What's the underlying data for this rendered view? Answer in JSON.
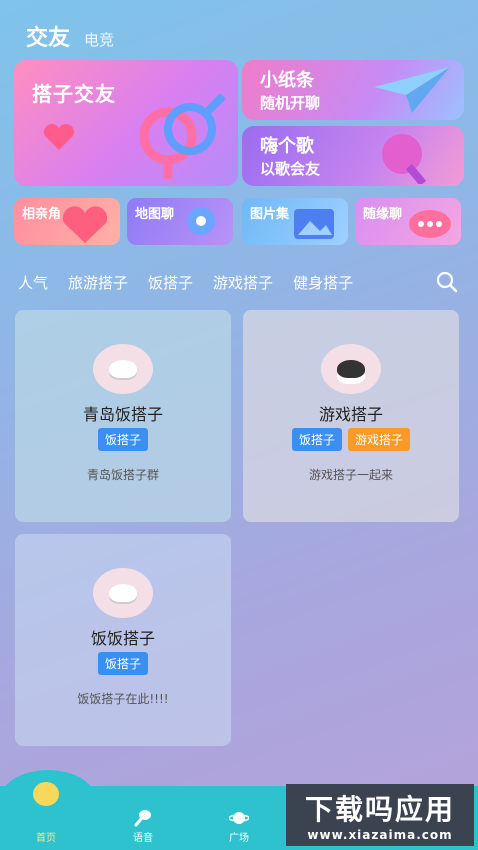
{
  "header": {
    "title": "交友",
    "subtitle": "电竞"
  },
  "banners": {
    "big": {
      "label": "搭子交友"
    },
    "note": {
      "title": "小纸条",
      "subtitle": "随机开聊"
    },
    "song": {
      "title": "嗨个歌",
      "subtitle": "以歌会友"
    }
  },
  "small_banners": [
    {
      "label": "相亲角"
    },
    {
      "label": "地图聊"
    },
    {
      "label": "图片集"
    },
    {
      "label": "随缘聊"
    }
  ],
  "tabs": [
    "人气",
    "旅游搭子",
    "饭搭子",
    "游戏搭子",
    "健身搭子"
  ],
  "cards": [
    {
      "title": "青岛饭搭子",
      "tags": [
        "饭搭子"
      ],
      "desc": "青岛饭搭子群"
    },
    {
      "title": "游戏搭子",
      "tags": [
        "饭搭子",
        "游戏搭子"
      ],
      "desc": "游戏搭子一起来"
    },
    {
      "title": "饭饭搭子",
      "tags": [
        "饭搭子"
      ],
      "desc": "饭饭搭子在此!!!!"
    }
  ],
  "nav": [
    "首页",
    "语音",
    "广场",
    ""
  ],
  "watermark": {
    "main": "下载吗应用",
    "url": "www.xiazaima.com"
  },
  "colors": {
    "nav": "#2ec2cf",
    "tag_blue": "#3a8ff0",
    "tag_orange": "#f99a28"
  }
}
